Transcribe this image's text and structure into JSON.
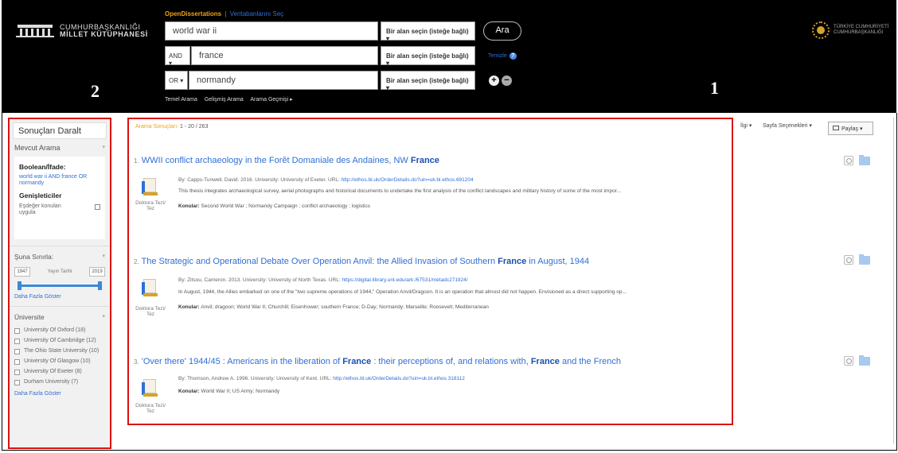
{
  "header": {
    "logo_line1": "CUMHURBAŞKANLIĞI",
    "logo_line2": "MİLLET KÜTÜPHANESİ",
    "open_dissertations": "OpenDissertations",
    "separator": "|",
    "vt_link": "Veritabanlarını Seç",
    "search_rows": [
      {
        "operator": "",
        "term": "world war ii",
        "field": "Bir alan seçin (isteğe bağlı) ▾"
      },
      {
        "operator": "AND ▾",
        "term": "france",
        "field": "Bir alan seçin (isteğe bağlı) ▾"
      },
      {
        "operator": "OR ▾",
        "term": "normandy",
        "field": "Bir alan seçin (isteğe bağlı) ▾"
      }
    ],
    "search_button": "Ara",
    "clear_link": "Temizle",
    "help_icon": "?",
    "add_row": "+",
    "remove_row": "−",
    "links": [
      "Temel Arama",
      "Gelişmiş Arama",
      "Arama Geçmişi ▸"
    ],
    "tc_line1": "TÜRKİYE CUMHURİYETİ",
    "tc_line2": "CUMHURBAŞKANLIĞI"
  },
  "markers": {
    "results": "1",
    "sidebar": "2"
  },
  "sidebar": {
    "title": "Sonuçları Daralt",
    "current_search": "Mevcut Arama",
    "caret": "▾",
    "boolean_label": "Boolean/İfade:",
    "boolean_query": "world war ii AND france OR normandy",
    "expanders_label": "Genişleticiler",
    "expander_option": "Eşdeğer konuları uygula",
    "limit_label": "Şuna Sınırla:",
    "year_from": "1947",
    "year_label": "Yayın Tarihi",
    "year_to": "2019",
    "show_more": "Daha Fazla Göster",
    "university_label": "Üniversite",
    "universities": [
      "University Of Oxford (18)",
      "University Of Cambridge (12)",
      "The Ohio State University (10)",
      "University Of Glasgow (10)",
      "University Of Exeter (8)",
      "Durham University (7)"
    ],
    "show_more_2": "Daha Fazla Göster"
  },
  "results": {
    "label": "Arama Sonuçları:",
    "range": "1 - 20 / 263",
    "type_label": "Doktora Tezi/ Tez",
    "records": [
      {
        "index": "1.",
        "title_pre": "WWII conflict archaeology in the Forêt Domaniale des Andaines, NW ",
        "title_hl": "France",
        "title_post": "",
        "meta": "By: Capps-Tunwell, David. 2016. University: University of Exeter. URL: ",
        "url": "http://ethos.bl.uk/OrderDetails.do?uin=uk.bl.ethos.691204",
        "abstract": "This thesis integrates archaeological survey, aerial photographs and historical documents to undertake the first analysis of the conflict landscapes and military history of some of the most impor...",
        "subjects_label": "Konular:",
        "subjects": "Second World War ; Normandy Campaign ; conflict archaeology ; logistics"
      },
      {
        "index": "2.",
        "title_pre": "The Strategic and Operational Debate Over Operation Anvil: the Allied Invasion of Southern ",
        "title_hl": "France",
        "title_post": " in August, 1944",
        "meta": "By: Zitsou, Cameron. 2013. University: University of North Texas. URL: ",
        "url": "https://digital.library.unt.edu/ark:/67531/metadc271924/",
        "abstract": "In August, 1944, the Allies embarked on one of the \"two supreme operations of 1944,\" Operation Anvil/Dragoon. It is an operation that almost did not happen. Envisioned as a direct supporting op...",
        "subjects_label": "Konular:",
        "subjects": "Anvil; dragoon; World War II; Churchill; Eisenhower; southern France; D-Day; Normandy; Marseille; Roosevelt; Mediterranean"
      },
      {
        "index": "3.",
        "title_pre": "'Over there' 1944/45 : Americans in the liberation of ",
        "title_hl": "France",
        "title_post": " : their perceptions of, and relations with, ",
        "title_hl2": "France",
        "title_post2": " and the French",
        "meta": "By: Thomson, Andrew A. 1996. University: University of Kent. URL: ",
        "url": "http://ethos.bl.uk/OrderDetails.do?uin=uk.bl.ethos.318112",
        "subjects_label": "Konular:",
        "subjects": "World War II; US Army; Normandy"
      }
    ]
  },
  "toolbar": {
    "relevance": "İlgi ▾",
    "page_options": "Sayfa Seçenekleri ▾",
    "share": "Paylaş ▾"
  }
}
